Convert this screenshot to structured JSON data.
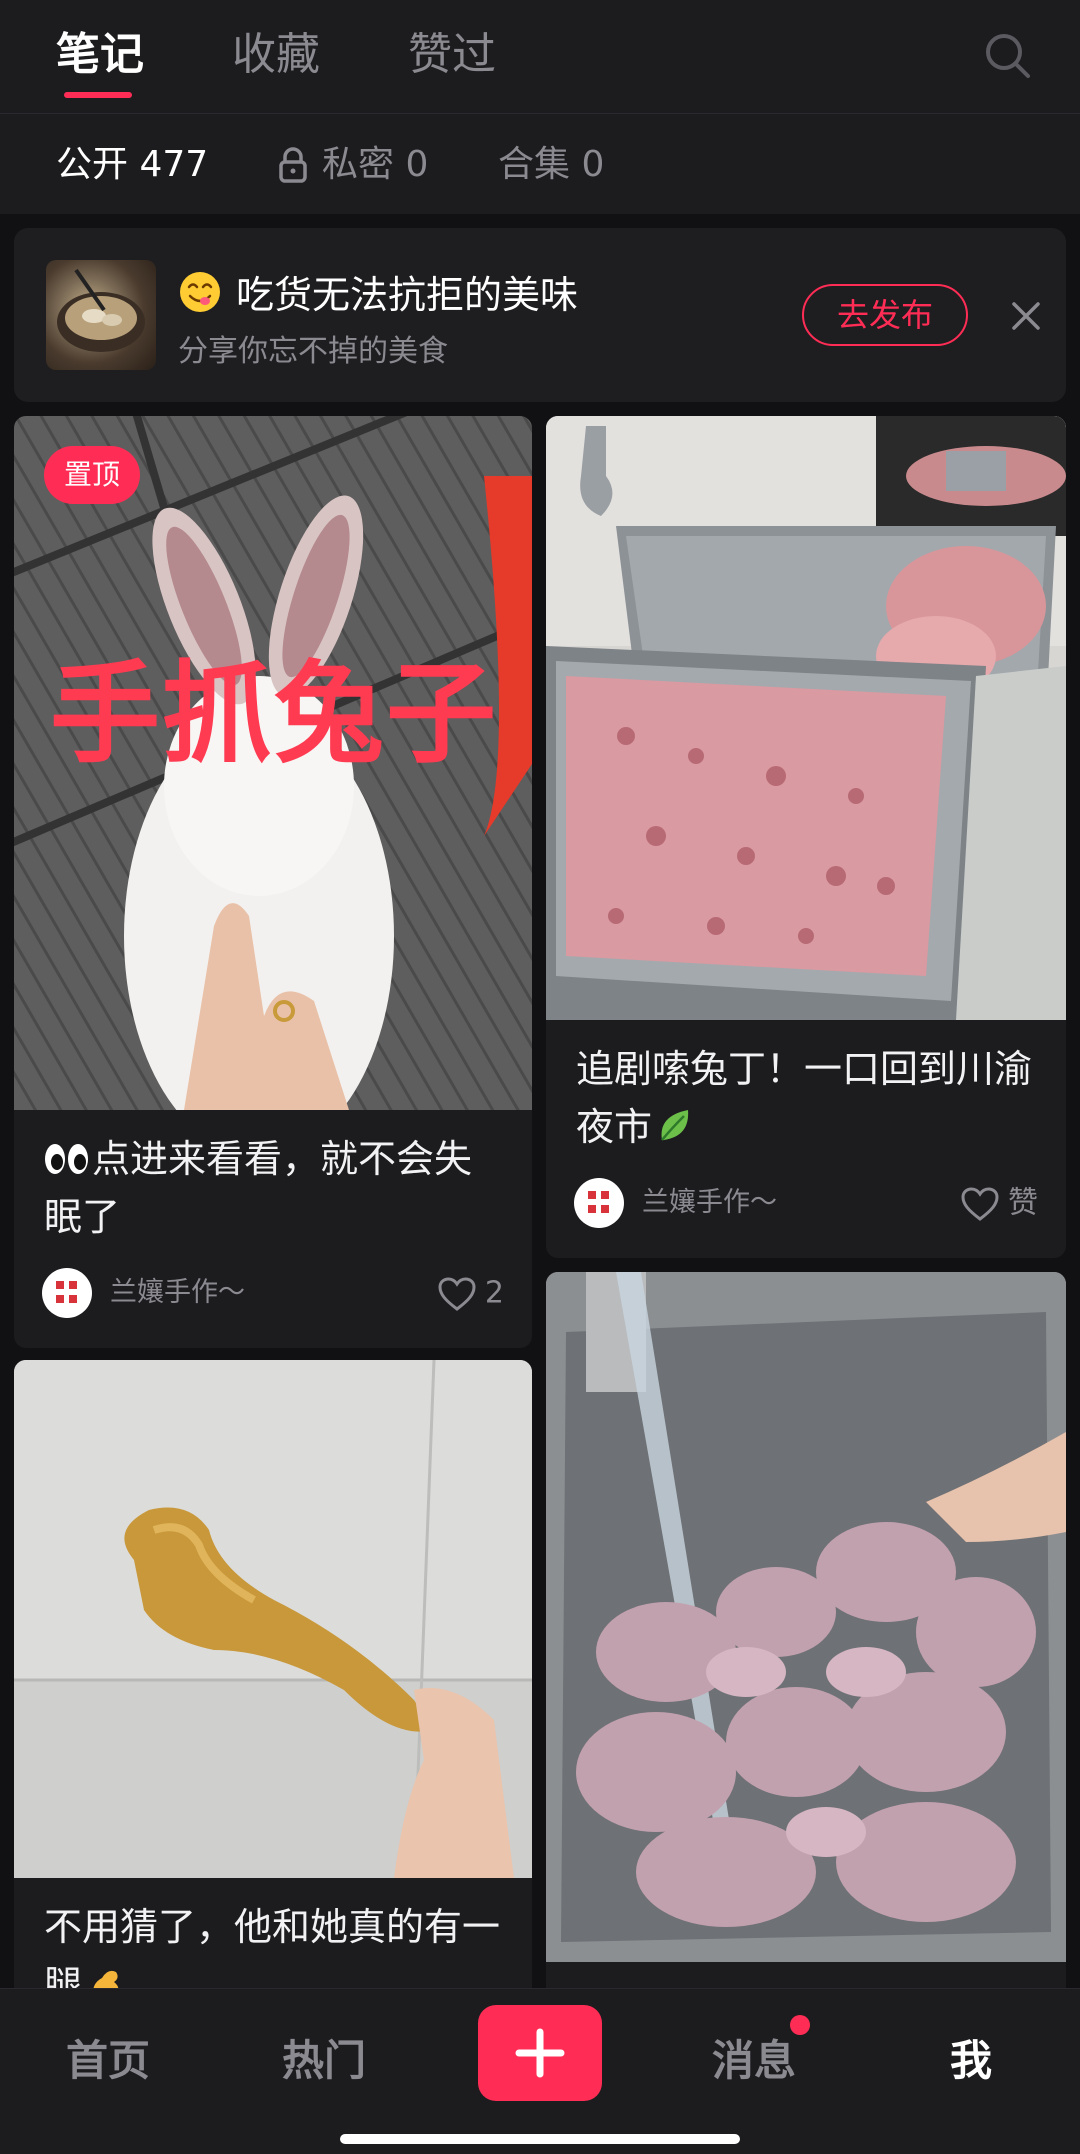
{
  "tabs": [
    {
      "label": "笔记",
      "active": true
    },
    {
      "label": "收藏",
      "active": false
    },
    {
      "label": "赞过",
      "active": false
    }
  ],
  "search_icon": "search-icon",
  "filters": [
    {
      "label": "公开 477",
      "active": true
    },
    {
      "label": "私密 0",
      "icon": "lock-icon",
      "active": false
    },
    {
      "label": "合集 0",
      "active": false
    }
  ],
  "banner": {
    "title": "吃货无法抗拒的美味",
    "title_emoji": "yum-emoji-icon",
    "subtitle": "分享你忘不掉的美食",
    "button": "去发布",
    "close_icon": "close-icon"
  },
  "notes": [
    {
      "pin_label": "置顶",
      "image_text": "手抓兔子",
      "title": "点进来看看，就不会失眠了",
      "title_emoji": "eyes-emoji-icon",
      "author": "兰孃手作～",
      "likes": "2"
    },
    {
      "title": "追剧嗦兔丁！一口回到川渝夜市",
      "title_emoji": "leaf-emoji-icon",
      "author": "兰孃手作～",
      "likes": "赞"
    },
    {
      "title": "不用猜了，他和她真的有一腿",
      "title_emoji": "flexed-arm-emoji-icon"
    },
    {}
  ],
  "bottom_nav": [
    {
      "label": "首页",
      "active": false
    },
    {
      "label": "热门",
      "active": false
    },
    {
      "label": "消息",
      "active": false,
      "unread": true
    },
    {
      "label": "我",
      "active": true
    }
  ],
  "colors": {
    "accent": "#ff2d55",
    "background": "#111113",
    "card": "#1c1c1f"
  }
}
